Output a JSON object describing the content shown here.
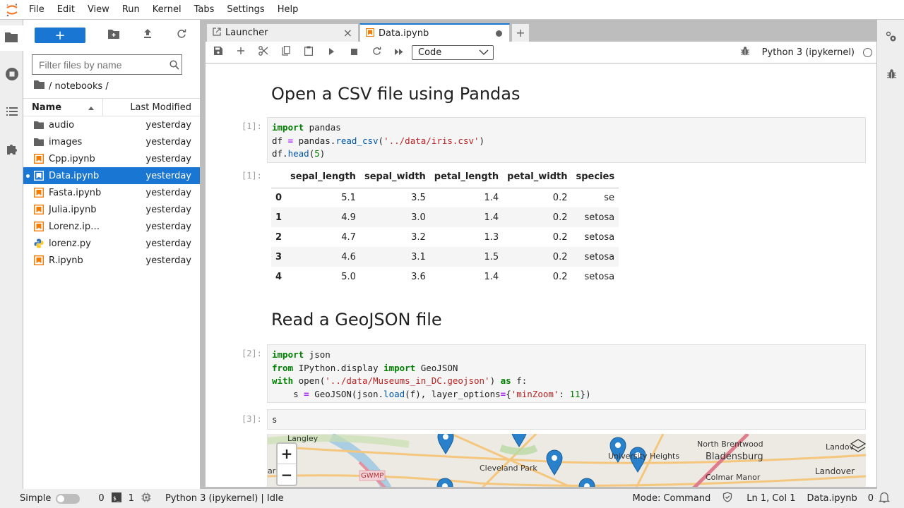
{
  "menubar": {
    "items": [
      "File",
      "Edit",
      "View",
      "Run",
      "Kernel",
      "Tabs",
      "Settings",
      "Help"
    ]
  },
  "filebrowser": {
    "new_label": "+",
    "filter_placeholder": "Filter files by name",
    "breadcrumb": "/ notebooks /",
    "col_name": "Name",
    "col_modified": "Last Modified",
    "files": [
      {
        "name": "audio",
        "type": "folder",
        "modified": "yesterday"
      },
      {
        "name": "images",
        "type": "folder",
        "modified": "yesterday"
      },
      {
        "name": "Cpp.ipynb",
        "type": "notebook",
        "modified": "yesterday"
      },
      {
        "name": "Data.ipynb",
        "type": "notebook",
        "modified": "yesterday",
        "selected": true,
        "running": true
      },
      {
        "name": "Fasta.ipynb",
        "type": "notebook",
        "modified": "yesterday"
      },
      {
        "name": "Julia.ipynb",
        "type": "notebook",
        "modified": "yesterday"
      },
      {
        "name": "Lorenz.ip…",
        "type": "notebook",
        "modified": "yesterday"
      },
      {
        "name": "lorenz.py",
        "type": "python",
        "modified": "yesterday"
      },
      {
        "name": "R.ipynb",
        "type": "notebook",
        "modified": "yesterday"
      }
    ]
  },
  "tabs": [
    {
      "label": "Launcher",
      "icon": "launcher-icon",
      "close": "×"
    },
    {
      "label": "Data.ipynb",
      "icon": "notebook-icon",
      "active": true,
      "dirty": true
    }
  ],
  "toolbar": {
    "cell_type": "Code",
    "kernel_name": "Python 3 (ipykernel)"
  },
  "notebook": {
    "heading1": "Open a CSV file using Pandas",
    "prompt1": "[1]:",
    "out_prompt1": "[1]:",
    "table": {
      "columns": [
        "",
        "sepal_length",
        "sepal_width",
        "petal_length",
        "petal_width",
        "species"
      ],
      "rows": [
        [
          "0",
          "5.1",
          "3.5",
          "1.4",
          "0.2",
          "se"
        ],
        [
          "1",
          "4.9",
          "3.0",
          "1.4",
          "0.2",
          "setosa"
        ],
        [
          "2",
          "4.7",
          "3.2",
          "1.3",
          "0.2",
          "setosa"
        ],
        [
          "3",
          "4.6",
          "3.1",
          "1.5",
          "0.2",
          "setosa"
        ],
        [
          "4",
          "5.0",
          "3.6",
          "1.4",
          "0.2",
          "setosa"
        ]
      ]
    },
    "heading2": "Read a GeoJSON file",
    "prompt2": "[2]:",
    "prompt3": "[3]:",
    "cell3_code": "s",
    "map": {
      "zoom_in": "+",
      "zoom_out": "−",
      "labels": [
        "Langley",
        "GWMP",
        "Cleveland Park",
        "University Heights",
        "North Brentwood",
        "Bladensburg",
        "Landover",
        "Colmar Manor",
        "Landov",
        "ar"
      ]
    }
  },
  "statusbar": {
    "mode_label": "Simple",
    "terminals": "0",
    "kernels": "1",
    "kernel_status": "Python 3 (ipykernel) | Idle",
    "mode": "Mode: Command",
    "cursor": "Ln 1, Col 1",
    "filename": "Data.ipynb",
    "notifications": "0"
  },
  "colors": {
    "accent": "#1976d2",
    "notebook_orange": "#f57c00"
  }
}
